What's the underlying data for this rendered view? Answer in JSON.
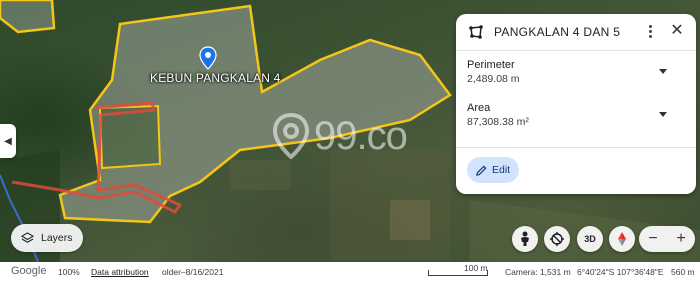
{
  "map": {
    "polygon_label": "KEBUN PANGKALAN 4",
    "watermark": "99.co",
    "pin_color": "#1a73e8",
    "boundary_color": "#f5c518",
    "route_color": "#e04a3c"
  },
  "panel": {
    "title": "PANGKALAN 4 DAN 5",
    "metrics": [
      {
        "label": "Perimeter",
        "value": "2,489.08 m"
      },
      {
        "label": "Area",
        "value": "87,308.38 m²"
      }
    ],
    "edit_label": "Edit"
  },
  "controls": {
    "layers_label": "Layers",
    "threed_label": "3D"
  },
  "status_bar": {
    "brand": "Google",
    "zoom": "100%",
    "attribution": "Data attribution",
    "imagery_date": "older–8/16/2021",
    "scale_label": "100 m",
    "camera": "Camera: 1,531 m",
    "coordinates": "6°40'24\"S 107°36'48\"E",
    "elevation": "560 m"
  }
}
